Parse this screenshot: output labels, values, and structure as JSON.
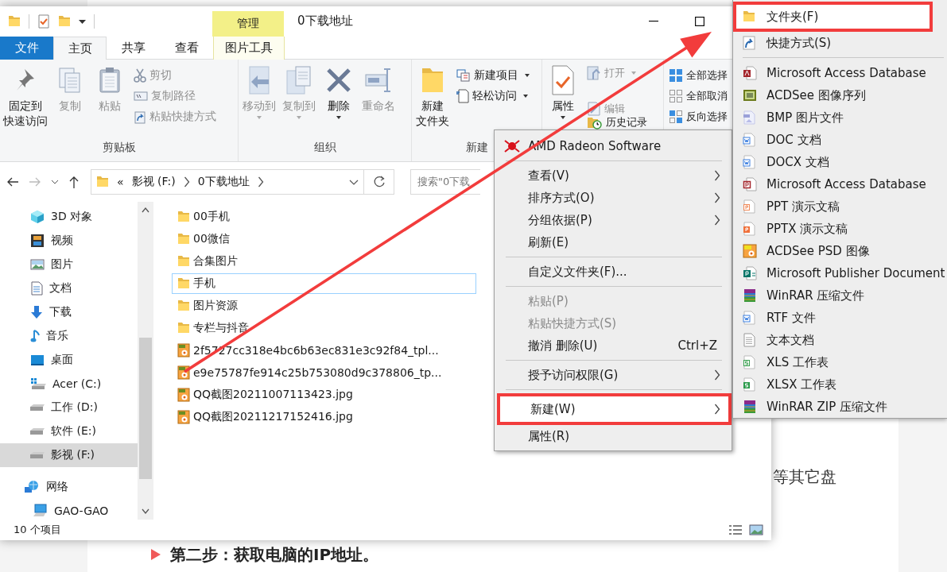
{
  "article": {
    "fragment": "等其它盘",
    "heading": "第二步：获取电脑的IP地址。"
  },
  "explorer": {
    "contextual_group": "管理",
    "title": "0下载地址",
    "tabs": [
      {
        "label": "文件",
        "kind": "file",
        "selected": false
      },
      {
        "label": "主页",
        "kind": "tab",
        "selected": true
      },
      {
        "label": "共享",
        "kind": "tab",
        "selected": false
      },
      {
        "label": "查看",
        "kind": "tab",
        "selected": false
      },
      {
        "label": "图片工具",
        "kind": "contextual",
        "selected": false
      }
    ],
    "ribbon_groups": [
      {
        "label": "剪贴板",
        "commands": [
          {
            "label": [
              "固定到",
              "快速访问"
            ],
            "kind": "large",
            "disabled": false
          },
          {
            "label": "复制",
            "kind": "large",
            "disabled": true
          },
          {
            "label": "粘贴",
            "kind": "large",
            "disabled": true
          },
          {
            "label": "剪切",
            "kind": "small",
            "disabled": true
          },
          {
            "label": "复制路径",
            "kind": "small",
            "disabled": true
          },
          {
            "label": "粘贴快捷方式",
            "kind": "small",
            "disabled": true
          }
        ]
      },
      {
        "label": "组织",
        "commands": [
          {
            "label": "移动到",
            "kind": "large",
            "disabled": true,
            "dropdown": true
          },
          {
            "label": "复制到",
            "kind": "large",
            "disabled": true,
            "dropdown": true
          },
          {
            "label": "删除",
            "kind": "large",
            "disabled": false,
            "dropdown": true
          },
          {
            "label": "重命名",
            "kind": "large",
            "disabled": true
          }
        ]
      },
      {
        "label": "新建",
        "commands": [
          {
            "label": [
              "新建",
              "文件夹"
            ],
            "kind": "large",
            "disabled": false
          },
          {
            "label": "新建项目",
            "kind": "small",
            "disabled": false,
            "dropdown": true
          },
          {
            "label": "轻松访问",
            "kind": "small",
            "disabled": false,
            "dropdown": true
          }
        ]
      },
      {
        "commands": [
          {
            "label": "属性",
            "kind": "large",
            "disabled": false,
            "dropdown": true
          },
          {
            "label": "打开",
            "kind": "small",
            "disabled": true,
            "dropdown": true
          },
          {
            "label": "编辑",
            "kind": "small",
            "disabled": true
          },
          {
            "label": "历史记录",
            "kind": "small",
            "disabled": false
          }
        ]
      },
      {
        "commands": [
          {
            "label": "全部选择",
            "kind": "small",
            "disabled": false
          },
          {
            "label": "全部取消",
            "kind": "small",
            "disabled": false
          },
          {
            "label": "反向选择",
            "kind": "small",
            "disabled": false
          }
        ]
      }
    ],
    "address": {
      "overflow": "«",
      "path": [
        "影视 (F:)",
        "0下载地址"
      ],
      "search_placeholder": "搜索\"0下载"
    },
    "sidebar": {
      "items": [
        {
          "label": "3D 对象",
          "selected": false
        },
        {
          "label": "视频",
          "selected": false
        },
        {
          "label": "图片",
          "selected": false
        },
        {
          "label": "文档",
          "selected": false
        },
        {
          "label": "下载",
          "selected": false
        },
        {
          "label": "音乐",
          "selected": false
        },
        {
          "label": "桌面",
          "selected": false
        },
        {
          "label": "Acer (C:)",
          "selected": false
        },
        {
          "label": "工作 (D:)",
          "selected": false
        },
        {
          "label": "软件 (E:)",
          "selected": false
        },
        {
          "label": "影视 (F:)",
          "selected": true
        },
        {
          "label": "网络",
          "selected": false,
          "children": [
            {
              "label": "GAO-GAO",
              "selected": false
            }
          ]
        }
      ]
    },
    "files": [
      {
        "name": "00手机",
        "kind": "folder",
        "focused": false
      },
      {
        "name": "00微信",
        "kind": "folder",
        "focused": false
      },
      {
        "name": "合集图片",
        "kind": "folder",
        "focused": false
      },
      {
        "name": "手机",
        "kind": "folder",
        "focused": true
      },
      {
        "name": "图片资源",
        "kind": "folder",
        "focused": false
      },
      {
        "name": "专栏与抖音",
        "kind": "folder",
        "focused": false
      },
      {
        "name": "2f5727cc318e4bc6b63ec831e3c92f84_tpl...",
        "kind": "image",
        "focused": false
      },
      {
        "name": "e9e75787fe914c25b753080d9c378806_tp...",
        "kind": "image",
        "focused": false
      },
      {
        "name": "QQ截图20211007113423.jpg",
        "kind": "image",
        "focused": false
      },
      {
        "name": "QQ截图20211217152416.jpg",
        "kind": "image",
        "focused": false
      }
    ],
    "status": "10 个项目"
  },
  "context_menu": {
    "items": [
      {
        "kind": "app",
        "label": "AMD Radeon Software"
      },
      {
        "kind": "separator"
      },
      {
        "kind": "item",
        "label": "查看(V)",
        "submenu": true,
        "disabled": false,
        "selected": false
      },
      {
        "kind": "item",
        "label": "排序方式(O)",
        "submenu": true,
        "disabled": false,
        "selected": false
      },
      {
        "kind": "item",
        "label": "分组依据(P)",
        "submenu": true,
        "disabled": false,
        "selected": false
      },
      {
        "kind": "item",
        "label": "刷新(E)",
        "submenu": false,
        "disabled": false,
        "selected": false
      },
      {
        "kind": "separator"
      },
      {
        "kind": "item",
        "label": "自定义文件夹(F)...",
        "submenu": false,
        "disabled": false,
        "selected": false
      },
      {
        "kind": "separator"
      },
      {
        "kind": "item",
        "label": "粘贴(P)",
        "submenu": false,
        "disabled": true,
        "selected": false
      },
      {
        "kind": "item",
        "label": "粘贴快捷方式(S)",
        "submenu": false,
        "disabled": true,
        "selected": false
      },
      {
        "kind": "item",
        "label": "撤消 删除(U)",
        "shortcut": "Ctrl+Z",
        "submenu": false,
        "disabled": false,
        "selected": false
      },
      {
        "kind": "separator"
      },
      {
        "kind": "item",
        "label": "授予访问权限(G)",
        "submenu": true,
        "disabled": false,
        "selected": false
      },
      {
        "kind": "separator"
      },
      {
        "kind": "item",
        "label": "新建(W)",
        "submenu": true,
        "disabled": false,
        "selected": true,
        "outlined": true
      },
      {
        "kind": "item",
        "label": "属性(R)",
        "submenu": false,
        "disabled": false,
        "selected": false
      }
    ]
  },
  "new_submenu": {
    "items": [
      {
        "kind": "item",
        "label": "文件夹(F)",
        "selected": true,
        "outlined": true
      },
      {
        "kind": "item",
        "label": "快捷方式(S)",
        "selected": false
      },
      {
        "kind": "separator"
      },
      {
        "kind": "item",
        "label": "Microsoft Access Database",
        "selected": false
      },
      {
        "kind": "item",
        "label": "ACDSee 图像序列",
        "selected": false
      },
      {
        "kind": "item",
        "label": "BMP 图片文件",
        "selected": false
      },
      {
        "kind": "item",
        "label": "DOC 文档",
        "selected": false
      },
      {
        "kind": "item",
        "label": "DOCX 文档",
        "selected": false
      },
      {
        "kind": "item",
        "label": "Microsoft Access Database",
        "selected": false
      },
      {
        "kind": "item",
        "label": "PPT 演示文稿",
        "selected": false
      },
      {
        "kind": "item",
        "label": "PPTX 演示文稿",
        "selected": false
      },
      {
        "kind": "item",
        "label": "ACDSee PSD 图像",
        "selected": false
      },
      {
        "kind": "item",
        "label": "Microsoft Publisher Document",
        "selected": false
      },
      {
        "kind": "item",
        "label": "WinRAR 压缩文件",
        "selected": false
      },
      {
        "kind": "item",
        "label": "RTF 文件",
        "selected": false
      },
      {
        "kind": "item",
        "label": "文本文档",
        "selected": false
      },
      {
        "kind": "item",
        "label": "XLS 工作表",
        "selected": false
      },
      {
        "kind": "item",
        "label": "XLSX 工作表",
        "selected": false
      },
      {
        "kind": "item",
        "label": "WinRAR ZIP 压缩文件",
        "selected": false
      }
    ]
  }
}
